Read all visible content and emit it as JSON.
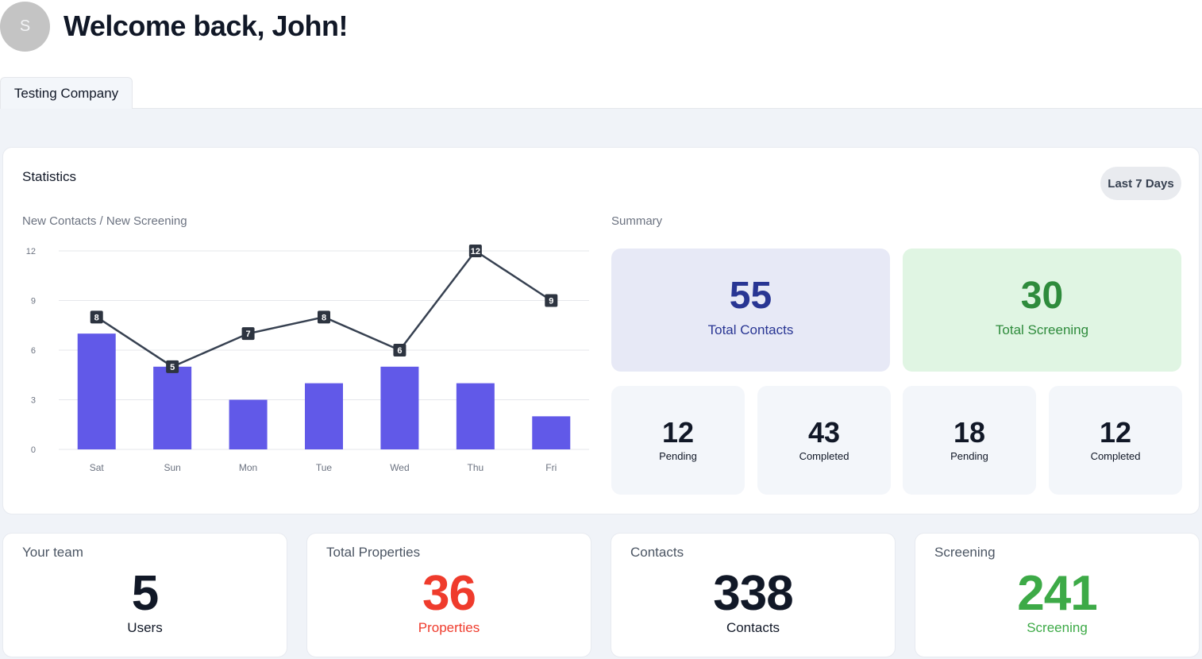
{
  "header": {
    "avatar_initial": "S",
    "welcome": "Welcome back, John!"
  },
  "tabs": [
    {
      "label": "Testing Company"
    }
  ],
  "statistics": {
    "title": "Statistics",
    "range_button": "Last 7 Days",
    "chart_title": "New Contacts / New Screening",
    "summary_title": "Summary",
    "total_contacts": {
      "value": "55",
      "label": "Total Contacts"
    },
    "total_screening": {
      "value": "30",
      "label": "Total Screening"
    },
    "breakdown": [
      {
        "value": "12",
        "label": "Pending"
      },
      {
        "value": "43",
        "label": "Completed"
      },
      {
        "value": "18",
        "label": "Pending"
      },
      {
        "value": "12",
        "label": "Completed"
      }
    ]
  },
  "bottom_cards": [
    {
      "title": "Your team",
      "value": "5",
      "label": "Users",
      "color": "#111827"
    },
    {
      "title": "Total Properties",
      "value": "36",
      "label": "Properties",
      "color": "#ef3b2c"
    },
    {
      "title": "Contacts",
      "value": "338",
      "label": "Contacts",
      "color": "#111827"
    },
    {
      "title": "Screening",
      "value": "241",
      "label": "Screening",
      "color": "#3daa47"
    }
  ],
  "colors": {
    "bar": "#6159e8",
    "line": "#374151",
    "contacts_box_bg": "#e7e9f6",
    "contacts_text": "#283593",
    "screening_box_bg": "#e0f5e3",
    "screening_text": "#2e8b3c"
  },
  "chart_data": {
    "type": "bar",
    "categories": [
      "Sat",
      "Sun",
      "Mon",
      "Tue",
      "Wed",
      "Thu",
      "Fri"
    ],
    "ylim": [
      0,
      12
    ],
    "yticks": [
      "0",
      "3",
      "6",
      "9",
      "12"
    ],
    "series": [
      {
        "type": "bar",
        "values": [
          7,
          5,
          3,
          4,
          5,
          4,
          2
        ]
      },
      {
        "type": "line",
        "values": [
          8,
          5,
          7,
          8,
          6,
          12,
          9
        ]
      }
    ],
    "grid": true
  }
}
